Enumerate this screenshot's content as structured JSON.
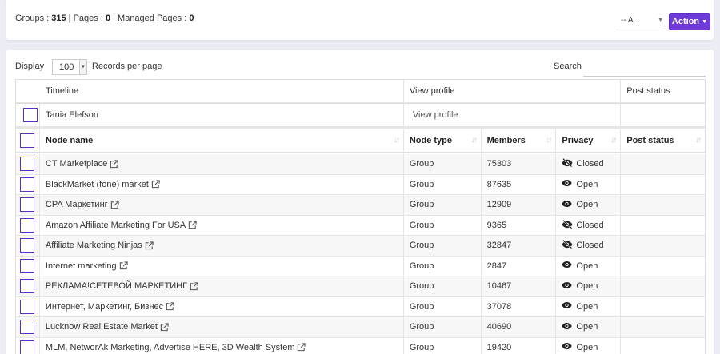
{
  "stats": {
    "groups_label": "Groups : ",
    "groups_value": "315",
    "pages_label": " | Pages : ",
    "pages_value": "0",
    "managed_label": " | Managed Pages : ",
    "managed_value": "0"
  },
  "toolbar": {
    "select_value": "-- A...",
    "action_label": "Action"
  },
  "table_controls": {
    "display_label": "Display",
    "display_value": "100",
    "records_label": "Records per page",
    "search_label": "Search",
    "search_placeholder": ""
  },
  "timeline": {
    "headers": {
      "timeline": "Timeline",
      "view_profile": "View profile",
      "post_status": "Post status"
    },
    "row": {
      "name": "Tania Elefson",
      "view_profile": "View profile",
      "post_status": ""
    }
  },
  "columns": {
    "node_name": "Node name",
    "node_type": "Node type",
    "members": "Members",
    "privacy": "Privacy",
    "post_status": "Post status"
  },
  "rows": [
    {
      "name": "CT Marketplace",
      "type": "Group",
      "members": "75303",
      "privacy": "Closed",
      "privacy_icon": "eye-slash-icon"
    },
    {
      "name": "BlackMarket (fone) market",
      "type": "Group",
      "members": "87635",
      "privacy": "Open",
      "privacy_icon": "eye-icon"
    },
    {
      "name": "CPA Маркетинг",
      "type": "Group",
      "members": "12909",
      "privacy": "Open",
      "privacy_icon": "eye-icon"
    },
    {
      "name": "Amazon Affiliate Marketing For USA",
      "type": "Group",
      "members": "9365",
      "privacy": "Closed",
      "privacy_icon": "eye-slash-icon"
    },
    {
      "name": "Affiliate Marketing Ninjas",
      "type": "Group",
      "members": "32847",
      "privacy": "Closed",
      "privacy_icon": "eye-slash-icon"
    },
    {
      "name": "Internet marketing",
      "type": "Group",
      "members": "2847",
      "privacy": "Open",
      "privacy_icon": "eye-icon"
    },
    {
      "name": "РЕКЛАМА!СЕТЕВОЙ МАРКЕТИНГ",
      "type": "Group",
      "members": "10467",
      "privacy": "Open",
      "privacy_icon": "eye-icon"
    },
    {
      "name": "Интернет, Маркетинг, Бизнес",
      "type": "Group",
      "members": "37078",
      "privacy": "Open",
      "privacy_icon": "eye-icon"
    },
    {
      "name": "Lucknow Real Estate Market",
      "type": "Group",
      "members": "40690",
      "privacy": "Open",
      "privacy_icon": "eye-icon"
    },
    {
      "name": "MLM, NetworAk Marketing, Advertise HERE, 3D Wealth System",
      "type": "Group",
      "members": "19420",
      "privacy": "Open",
      "privacy_icon": "eye-icon"
    }
  ],
  "colors": {
    "accent": "#6e3bd8",
    "checkbox_border": "#5b2fc4"
  }
}
